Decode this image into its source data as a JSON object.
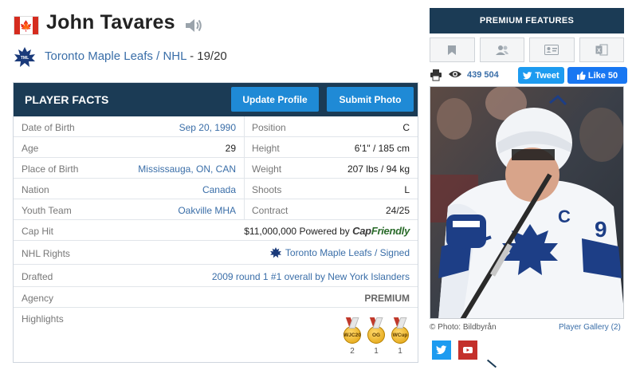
{
  "player": {
    "name": "John Tavares",
    "team": "Toronto Maple Leafs",
    "league": "NHL",
    "season": "19/20"
  },
  "facts": {
    "title": "PLAYER FACTS",
    "update_label": "Update Profile",
    "submit_label": "Submit Photo",
    "rows": [
      {
        "left_label": "Date of Birth",
        "left_value": "Sep 20, 1990",
        "right_label": "Position",
        "right_value": "C"
      },
      {
        "left_label": "Age",
        "left_value": "29",
        "right_label": "Height",
        "right_value": "6'1\" / 185 cm"
      },
      {
        "left_label": "Place of Birth",
        "left_value": "Mississauga, ON, CAN",
        "right_label": "Weight",
        "right_value": "207 lbs / 94 kg"
      },
      {
        "left_label": "Nation",
        "left_value": "Canada",
        "right_label": "Shoots",
        "right_value": "L"
      },
      {
        "left_label": "Youth Team",
        "left_value": "Oakville MHA",
        "right_label": "Contract",
        "right_value": "24/25"
      }
    ],
    "cap_hit": {
      "label": "Cap Hit",
      "value": "$11,000,000",
      "powered_by": "Powered by",
      "brand_a": "Cap",
      "brand_b": "Friendly"
    },
    "nhl_rights": {
      "label": "NHL Rights",
      "value": "Toronto Maple Leafs / Signed"
    },
    "drafted": {
      "label": "Drafted",
      "value": "2009 round 1 #1 overall by New York Islanders"
    },
    "agency": {
      "label": "Agency",
      "value": "PREMIUM"
    },
    "highlights": {
      "label": "Highlights",
      "medals": [
        {
          "abbr": "WJC20",
          "count": "2"
        },
        {
          "abbr": "OG",
          "count": "1"
        },
        {
          "abbr": "WCup",
          "count": "1"
        }
      ]
    }
  },
  "sidebar": {
    "premium_title": "PREMIUM FEATURES",
    "views": "439 504",
    "tweet_label": "Tweet",
    "like_label": "Like 50",
    "photo_credit": "© Photo: Bildbyrån",
    "gallery_label": "Player Gallery (2)"
  },
  "colors": {
    "navy": "#1b3b55",
    "button_blue": "#1f8ad6",
    "link_blue": "#3a6ea8",
    "twitter": "#1d9bf0",
    "facebook": "#1877f2",
    "youtube": "#c4302b"
  },
  "icons": [
    "canada-flag-icon",
    "speaker-icon",
    "maple-leafs-logo-icon",
    "bookmark-icon",
    "users-icon",
    "id-card-icon",
    "excel-icon",
    "print-icon",
    "eye-icon",
    "twitter-icon",
    "facebook-like-icon",
    "youtube-icon"
  ]
}
